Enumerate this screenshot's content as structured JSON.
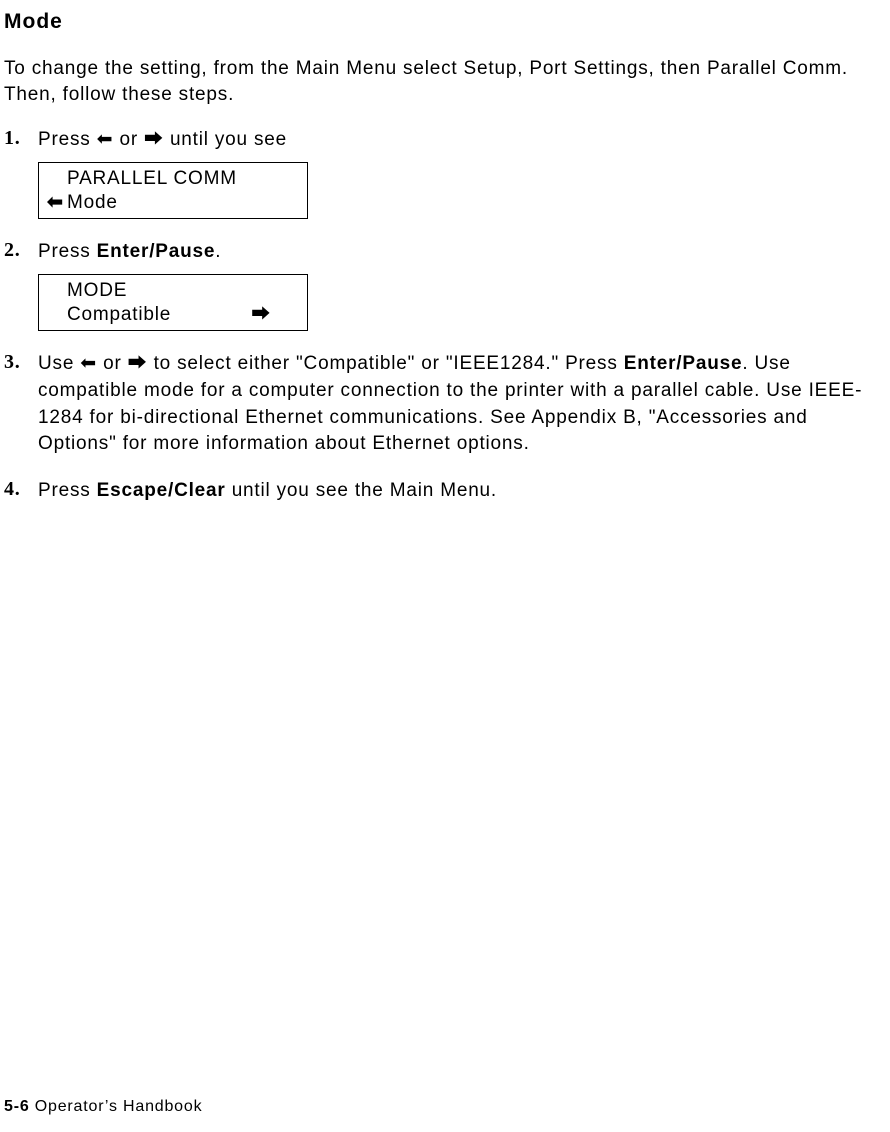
{
  "heading": "Mode",
  "intro": "To change the setting, from the Main Menu select Setup, Port Settings, then Parallel Comm.  Then, follow these steps.",
  "arrows": {
    "left": "⬅",
    "right": "⮕"
  },
  "steps": [
    {
      "num": "1.",
      "pre": "Press ",
      "mid": " or ",
      "post": " until you see",
      "display": {
        "leftArrow": "⬅",
        "line1": "PARALLEL COMM",
        "line2": "Mode"
      }
    },
    {
      "num": "2.",
      "pre": "Press ",
      "bold": "Enter/Pause",
      "post": ".",
      "display": {
        "line1": "MODE",
        "line2": "Compatible",
        "rightArrow": "⮕"
      }
    },
    {
      "num": "3.",
      "seg1": "Use ",
      "seg2": " or ",
      "seg3": " to select either \"Compatible\" or \"IEEE1284.\"  Press ",
      "bold": "Enter/Pause",
      "seg4": ".  Use compatible mode for a computer connection to the printer with a parallel cable.  Use IEEE-1284 for bi-directional Ethernet communications.  See Appendix B, \"Accessories and Options\" for more information about Ethernet options."
    },
    {
      "num": "4.",
      "pre": "Press ",
      "bold": "Escape/Clear",
      "post": " until you see the Main Menu."
    }
  ],
  "footer": {
    "page": "5-6",
    "title": "  Operator’s Handbook"
  }
}
